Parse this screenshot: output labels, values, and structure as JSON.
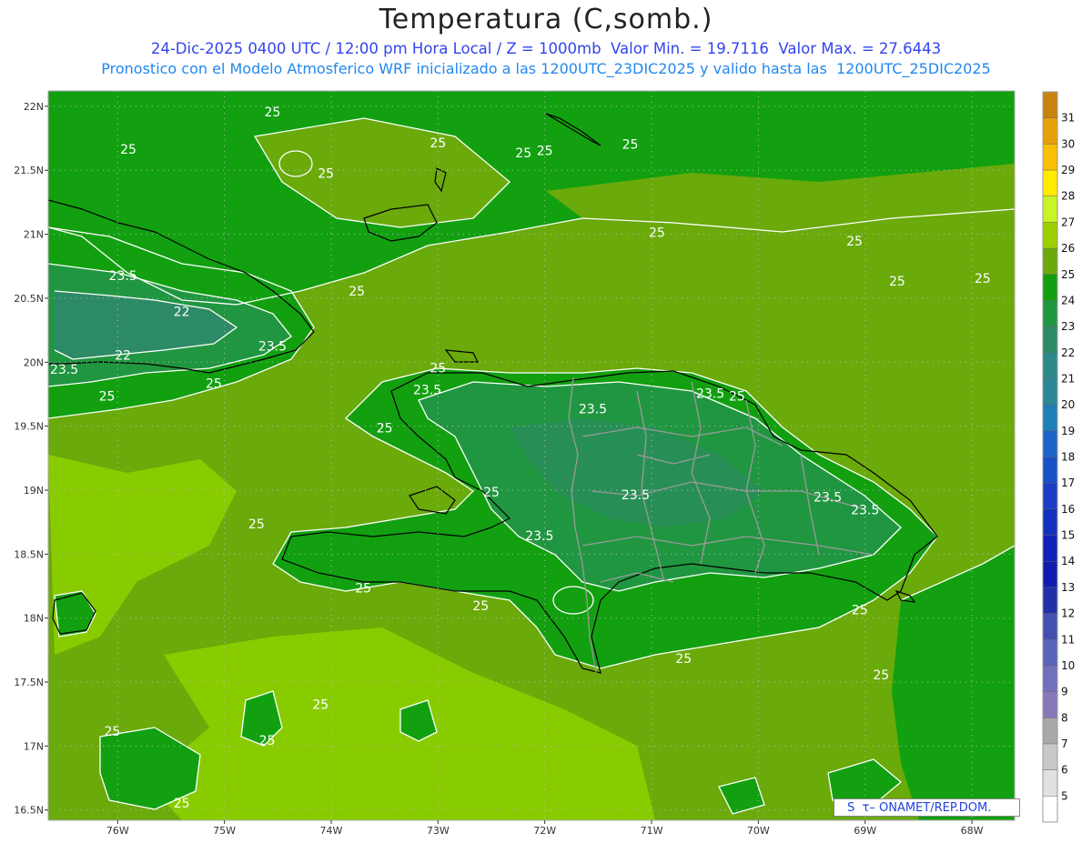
{
  "title": "Temperatura (C,somb.)",
  "subtitle_line1": "24-Dic-2025 0400 UTC / 12:00 pm Hora Local / Z = 1000mb  Valor Min. = 19.7116  Valor Max. = 27.6443",
  "subtitle_line2": "Pronostico con el Modelo Atmosferico WRF inicializado a las 1200UTC_23DIC2025 y valido hasta las  1200UTC_25DIC2025",
  "credit": "S  τ– ONAMET/REP.DOM.",
  "colors": {
    "level_24": "#12a010",
    "level_25": "#6aaa0a",
    "level_26": "#88cc00",
    "level_23": "#209640",
    "level_22": "#2d8a66",
    "contour": "#ffffff",
    "coast": "#000000",
    "province_border": "#999999"
  },
  "lat_labels": [
    "22N",
    "21.5N",
    "21N",
    "20.5N",
    "20N",
    "19.5N",
    "19N",
    "18.5N",
    "18N",
    "17.5N",
    "17N",
    "16.5N"
  ],
  "lon_labels": [
    "76W",
    "75W",
    "74W",
    "73W",
    "72W",
    "71W",
    "70W",
    "69W",
    "68W"
  ],
  "contour_labels": [
    {
      "text": "25",
      "lon": -74.55,
      "lat": 21.92
    },
    {
      "text": "25",
      "lon": -75.9,
      "lat": 21.63
    },
    {
      "text": "25",
      "lon": -74.05,
      "lat": 21.44
    },
    {
      "text": "25",
      "lon": -73.0,
      "lat": 21.68
    },
    {
      "text": "25",
      "lon": -72.2,
      "lat": 21.6
    },
    {
      "text": "25",
      "lon": -72.0,
      "lat": 21.62
    },
    {
      "text": "25",
      "lon": -71.2,
      "lat": 21.67
    },
    {
      "text": "25",
      "lon": -70.95,
      "lat": 20.98
    },
    {
      "text": "25",
      "lon": -69.1,
      "lat": 20.91
    },
    {
      "text": "25",
      "lon": -68.7,
      "lat": 20.6
    },
    {
      "text": "25",
      "lon": -67.9,
      "lat": 20.62
    },
    {
      "text": "25",
      "lon": -73.76,
      "lat": 20.52
    },
    {
      "text": "23.5",
      "lon": -75.95,
      "lat": 20.64
    },
    {
      "text": "22",
      "lon": -75.4,
      "lat": 20.36
    },
    {
      "text": "22",
      "lon": -75.95,
      "lat": 20.02
    },
    {
      "text": "23.5",
      "lon": -74.55,
      "lat": 20.09
    },
    {
      "text": "23.5",
      "lon": -76.5,
      "lat": 19.91
    },
    {
      "text": "25",
      "lon": -75.1,
      "lat": 19.8
    },
    {
      "text": "25",
      "lon": -76.1,
      "lat": 19.7
    },
    {
      "text": "25",
      "lon": -73.0,
      "lat": 19.92
    },
    {
      "text": "23.5",
      "lon": -73.1,
      "lat": 19.75
    },
    {
      "text": "23.5",
      "lon": -71.55,
      "lat": 19.6
    },
    {
      "text": "23.5",
      "lon": -70.45,
      "lat": 19.72
    },
    {
      "text": "25",
      "lon": -70.2,
      "lat": 19.7
    },
    {
      "text": "25",
      "lon": -73.5,
      "lat": 19.45
    },
    {
      "text": "25",
      "lon": -72.5,
      "lat": 18.95
    },
    {
      "text": "23.5",
      "lon": -71.15,
      "lat": 18.93
    },
    {
      "text": "23.5",
      "lon": -69.35,
      "lat": 18.91
    },
    {
      "text": "23.5",
      "lon": -69.0,
      "lat": 18.81
    },
    {
      "text": "25",
      "lon": -74.7,
      "lat": 18.7
    },
    {
      "text": "23.5",
      "lon": -72.05,
      "lat": 18.61
    },
    {
      "text": "25",
      "lon": -73.7,
      "lat": 18.2
    },
    {
      "text": "25",
      "lon": -72.6,
      "lat": 18.06
    },
    {
      "text": "25",
      "lon": -69.05,
      "lat": 18.03
    },
    {
      "text": "25",
      "lon": -70.7,
      "lat": 17.65
    },
    {
      "text": "25",
      "lon": -68.85,
      "lat": 17.52
    },
    {
      "text": "25",
      "lon": -74.1,
      "lat": 17.29
    },
    {
      "text": "25",
      "lon": -76.05,
      "lat": 17.08
    },
    {
      "text": "25",
      "lon": -74.6,
      "lat": 17.01
    },
    {
      "text": "25",
      "lon": -75.4,
      "lat": 16.52
    }
  ],
  "colorbar": {
    "labels": [
      "31",
      "30",
      "29",
      "28",
      "27",
      "26",
      "25",
      "24",
      "23",
      "22",
      "21",
      "20",
      "19",
      "18",
      "17",
      "16",
      "15",
      "14",
      "13",
      "12",
      "11",
      "10",
      "9",
      "8",
      "7",
      "6",
      "5"
    ],
    "colors": [
      "#c8840a",
      "#e6a008",
      "#f8c000",
      "#ffea00",
      "#c8f428",
      "#9ad000",
      "#6aaa0a",
      "#12a010",
      "#209640",
      "#2d8a66",
      "#2b8a8a",
      "#2a8898",
      "#1d7eb8",
      "#1a64c8",
      "#1850c8",
      "#1c3cc8",
      "#1430c0",
      "#1020b8",
      "#101cb0",
      "#2030a8",
      "#4450b0",
      "#5a64b8",
      "#7070bc",
      "#8878b8",
      "#a8a8a8",
      "#c8c8c8",
      "#e0e0e0",
      "#ffffff"
    ]
  }
}
